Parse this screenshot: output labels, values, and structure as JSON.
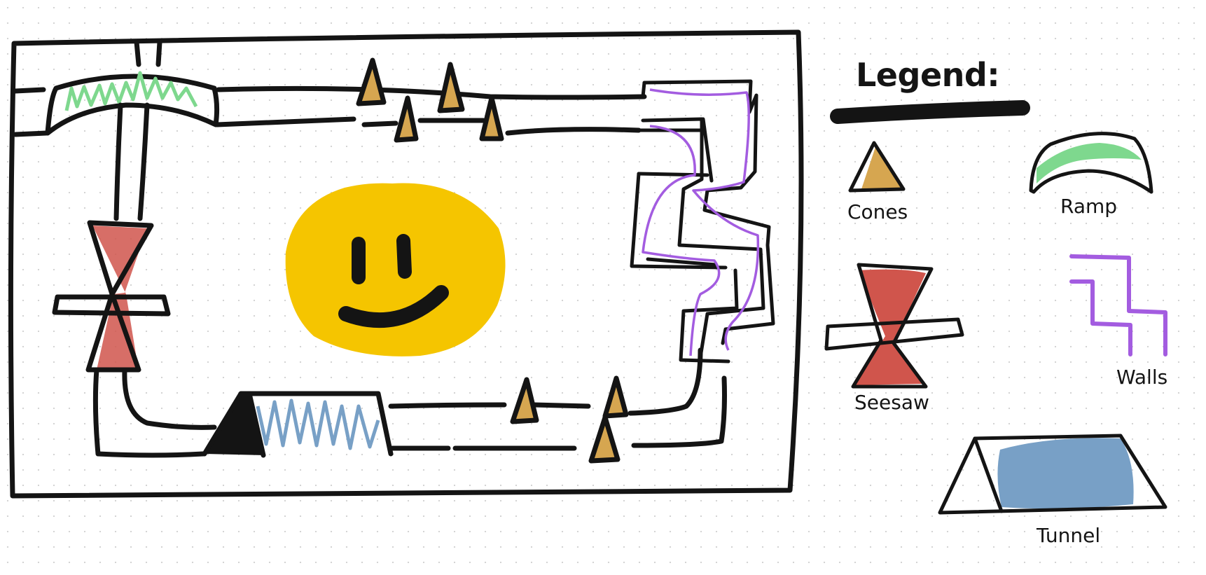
{
  "legend": {
    "title": "Legend:",
    "items": {
      "cones": "Cones",
      "ramp": "Ramp",
      "seesaw": "Seesaw",
      "walls": "Walls",
      "tunnel": "Tunnel"
    }
  },
  "colors": {
    "ink": "#141414",
    "ramp": "#7ed88e",
    "seesaw": "#d0554c",
    "cone": "#d6a650",
    "walls": "#a35ce0",
    "tunnel": "#78a0c6",
    "smiley": "#f5c500"
  }
}
